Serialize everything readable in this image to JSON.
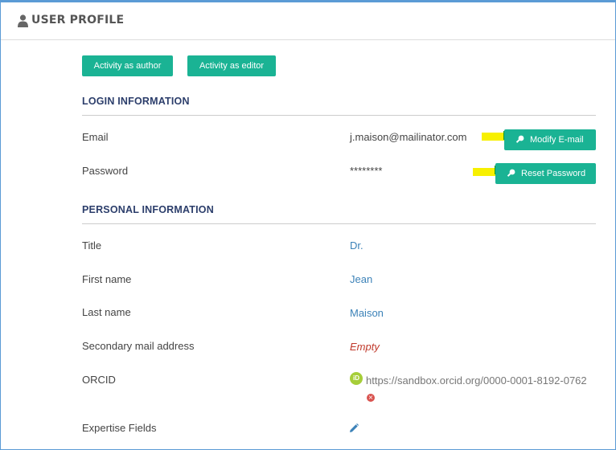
{
  "header": {
    "title": "USER PROFILE",
    "icon": "user-icon"
  },
  "actions": {
    "author": "Activity as author",
    "editor": "Activity as editor"
  },
  "login": {
    "title": "LOGIN INFORMATION",
    "email_label": "Email",
    "email_value": "j.maison@mailinator.com",
    "modify_email": "Modify E-mail",
    "password_label": "Password",
    "password_value": "********",
    "reset_password": "Reset Password"
  },
  "personal": {
    "title": "PERSONAL INFORMATION",
    "title_label": "Title",
    "title_value": "Dr.",
    "first_label": "First name",
    "first_value": "Jean",
    "last_label": "Last name",
    "last_value": "Maison",
    "secondary_label": "Secondary mail address",
    "secondary_value": "Empty",
    "orcid_label": "ORCID",
    "orcid_value": "https://sandbox.orcid.org/0000-0001-8192-0762",
    "orcid_badge": "iD",
    "expertise_label": "Expertise Fields"
  },
  "colors": {
    "accent": "#1ab394",
    "link": "#3c82b8",
    "section": "#2c3e6b",
    "empty": "#c0392b",
    "highlight": "#f7f000"
  }
}
